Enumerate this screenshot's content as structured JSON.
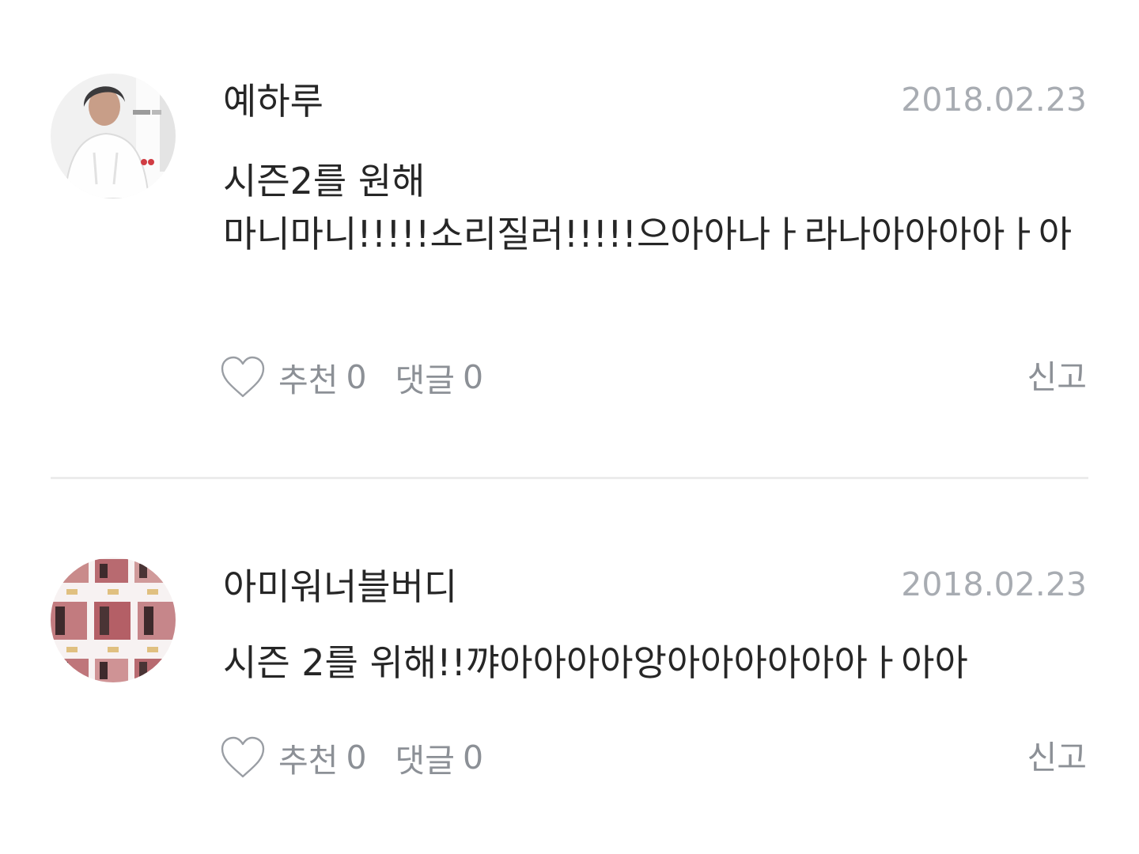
{
  "comments": [
    {
      "nickname": "예하루",
      "date": "2018.02.23",
      "text": "시즌2를 원해\n마니마니!!!!!소리질러!!!!!으아아나ㅏ라나아아아아ㅏ아",
      "like_label": "추천",
      "like_count": "0",
      "reply_label": "댓글",
      "reply_count": "0",
      "report_label": "신고",
      "avatar": "profile-photo-person-white-hoodie"
    },
    {
      "nickname": "아미워너블버디",
      "date": "2018.02.23",
      "text": "시즌 2를 위해!!꺄아아아아앙아아아아아아ㅏ아아",
      "like_label": "추천",
      "like_count": "0",
      "reply_label": "댓글",
      "reply_count": "0",
      "report_label": "신고",
      "avatar": "profile-photo-grid-collage"
    }
  ],
  "icons": {
    "like": "heart-outline-icon"
  },
  "colors": {
    "text": "#262626",
    "meta": "#a8acb2",
    "action": "#8c9096",
    "divider": "#ececec"
  }
}
